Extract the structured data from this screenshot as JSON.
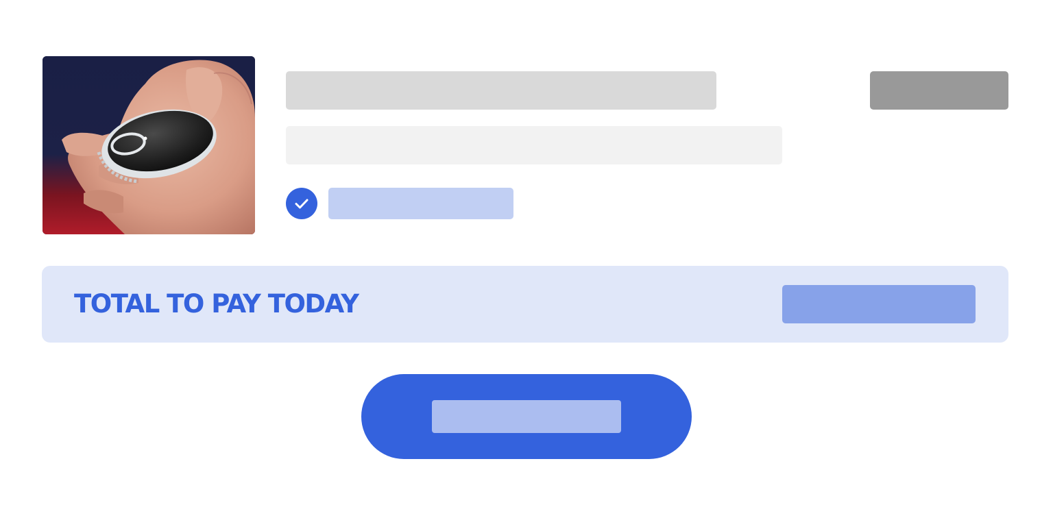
{
  "product": {
    "image_icon": "hand-holding-pendant-alarm-photo"
  },
  "summary": {
    "check_icon": "checkmark-icon"
  },
  "total": {
    "label": "TOTAL TO PAY TODAY"
  },
  "colors": {
    "accent": "#3462dd",
    "accent_light": "#e0e7f9",
    "placeholder_blue": "#87a2e9",
    "placeholder_light_blue": "#c1cff3",
    "placeholder_button_text": "#abbdf0",
    "placeholder_gray": "#d9d9d9",
    "placeholder_dark_gray": "#999999",
    "placeholder_light_gray": "#f2f2f2"
  }
}
